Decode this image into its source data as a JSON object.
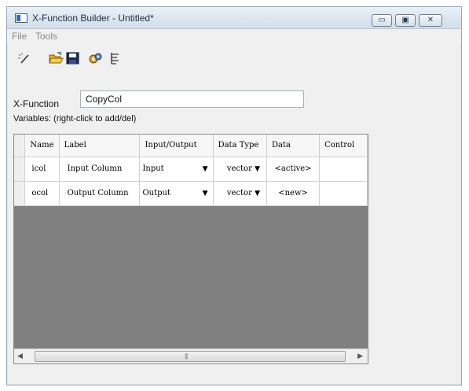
{
  "window": {
    "title": "X-Function Builder - Untitled*",
    "min_glyph": "▭",
    "max_glyph": "▣",
    "close_glyph": "✕"
  },
  "menu": {
    "file": "File",
    "tools": "Tools"
  },
  "toolbar": {
    "icons": [
      "new-wand-icon",
      "open-folder-icon",
      "save-disk-icon",
      "compile-icon",
      "tree-view-icon"
    ]
  },
  "xfunction": {
    "label": "X-Function",
    "value": "CopyCol"
  },
  "variables_label": "Variables: (right-click to add/del)",
  "grid": {
    "headers": [
      "Name",
      "Label",
      "Input/Output",
      "Data Type",
      "Data",
      "Control"
    ],
    "rows": [
      {
        "name": "icol",
        "label": "Input Column",
        "io": "Input",
        "type": "vector",
        "data": "<active>",
        "control": ""
      },
      {
        "name": "ocol",
        "label": "Output Column",
        "io": "Output",
        "type": "vector",
        "data": "<new>",
        "control": ""
      }
    ],
    "dropdown_glyph": "▼"
  },
  "scrollbar": {
    "left_glyph": "◀",
    "right_glyph": "▶",
    "grip": "|||"
  },
  "colors": {
    "grid_background": "#808080",
    "title_text": "#1e2d3f"
  }
}
